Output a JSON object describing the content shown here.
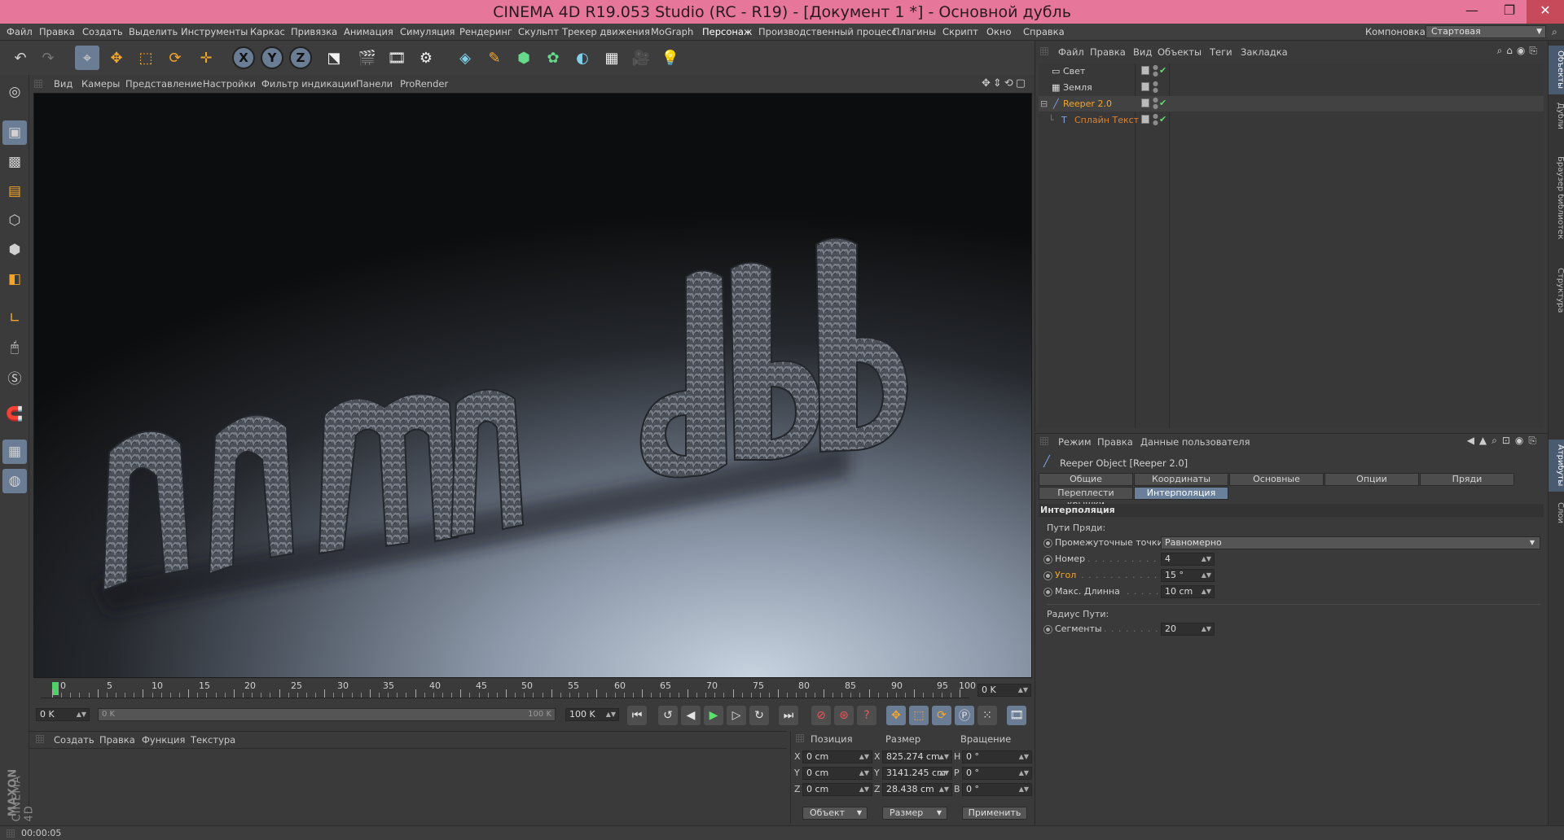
{
  "window": {
    "title": "CINEMA 4D R19.053 Studio (RC - R19) - [Документ 1 *] - Основной дубль",
    "minimize_glyph": "—",
    "maximize_glyph": "❐",
    "close_glyph": "✕"
  },
  "menubar": {
    "items": [
      "Файл",
      "Правка",
      "Создать",
      "Выделить",
      "Инструменты",
      "Каркас",
      "Привязка",
      "Анимация",
      "Симуляция",
      "Рендеринг",
      "Скульпт",
      "Трекер движения",
      "MoGraph",
      "Персонаж",
      "Производственный процесс",
      "Плагины",
      "Скрипт",
      "Окно",
      "Справка"
    ],
    "active_index": 13,
    "layout_label": "Компоновка",
    "layout_value": "Стартовая"
  },
  "toolbar": {
    "axis_x": "X",
    "axis_y": "Y",
    "axis_z": "Z"
  },
  "viewport": {
    "menu": [
      "Вид",
      "Камеры",
      "Представление",
      "Настройки",
      "Фильтр индикации",
      "Панели",
      "ProRender"
    ],
    "scene_text": "nnmdbb"
  },
  "timeline": {
    "ticks": [
      "0",
      "5",
      "10",
      "15",
      "20",
      "25",
      "30",
      "35",
      "40",
      "45",
      "50",
      "55",
      "60",
      "65",
      "70",
      "75",
      "80",
      "85",
      "90",
      "95",
      "100"
    ],
    "current_frame": "0 K",
    "start_field": "0 K",
    "range_start": "0 K",
    "range_end": "100 K",
    "end_field": "100 K"
  },
  "materials": {
    "menu": [
      "Создать",
      "Правка",
      "Функция",
      "Текстура"
    ],
    "brand_1": "MAXON",
    "brand_2": "CINEMA 4D"
  },
  "coords": {
    "headers": {
      "position": "Позиция",
      "size": "Размер",
      "rotation": "Вращение"
    },
    "rows": [
      {
        "axis": "X",
        "pos": "0 cm",
        "size_axis": "X",
        "size": "825.274 cm",
        "rot_axis": "H",
        "rot": "0 °"
      },
      {
        "axis": "Y",
        "pos": "0 cm",
        "size_axis": "Y",
        "size": "3141.245 cm",
        "rot_axis": "P",
        "rot": "0 °"
      },
      {
        "axis": "Z",
        "pos": "0 cm",
        "size_axis": "Z",
        "size": "28.438 cm",
        "rot_axis": "B",
        "rot": "0 °"
      }
    ],
    "mode_select": "Объект",
    "size_select": "Размер",
    "apply": "Применить"
  },
  "status": {
    "time": "00:00:05"
  },
  "object_manager": {
    "menu": [
      "Файл",
      "Правка",
      "Вид",
      "Объекты",
      "Теги",
      "Закладка"
    ],
    "objects": [
      {
        "name": "Свет",
        "style": "normal"
      },
      {
        "name": "Земля",
        "style": "normal"
      },
      {
        "name": "Reeper 2.0",
        "style": "orange"
      },
      {
        "name": "Сплайн Текст",
        "style": "orange-dim"
      }
    ]
  },
  "side_tabs": [
    "Объекты",
    "Дубли",
    "Браузер библиотек",
    "Структура",
    "Атрибуты",
    "Слои"
  ],
  "attributes": {
    "menu": [
      "Режим",
      "Правка",
      "Данные пользователя"
    ],
    "object_title": "Reeper Object [Reeper 2.0]",
    "tabs_row1": [
      "Общие",
      "Координаты",
      "Основные",
      "Опции",
      "Пряди"
    ],
    "tabs_row2": [
      "Переплести крышки",
      "Интерполяция"
    ],
    "active_tab": "Интерполяция",
    "section": "Интерполяция",
    "group1_label": "Пути Пряди:",
    "params": [
      {
        "label": "Промежуточные точки",
        "value": "Равномерно",
        "kind": "select"
      },
      {
        "label": "Номер",
        "value": "4",
        "kind": "field"
      },
      {
        "label": "Угол",
        "value": "15 °",
        "kind": "field",
        "highlight": true
      },
      {
        "label": "Макс. Длинна",
        "value": "10 cm",
        "kind": "field"
      }
    ],
    "group2_label": "Радиус Пути:",
    "params2": [
      {
        "label": "Сегменты",
        "value": "20",
        "kind": "field"
      }
    ]
  }
}
